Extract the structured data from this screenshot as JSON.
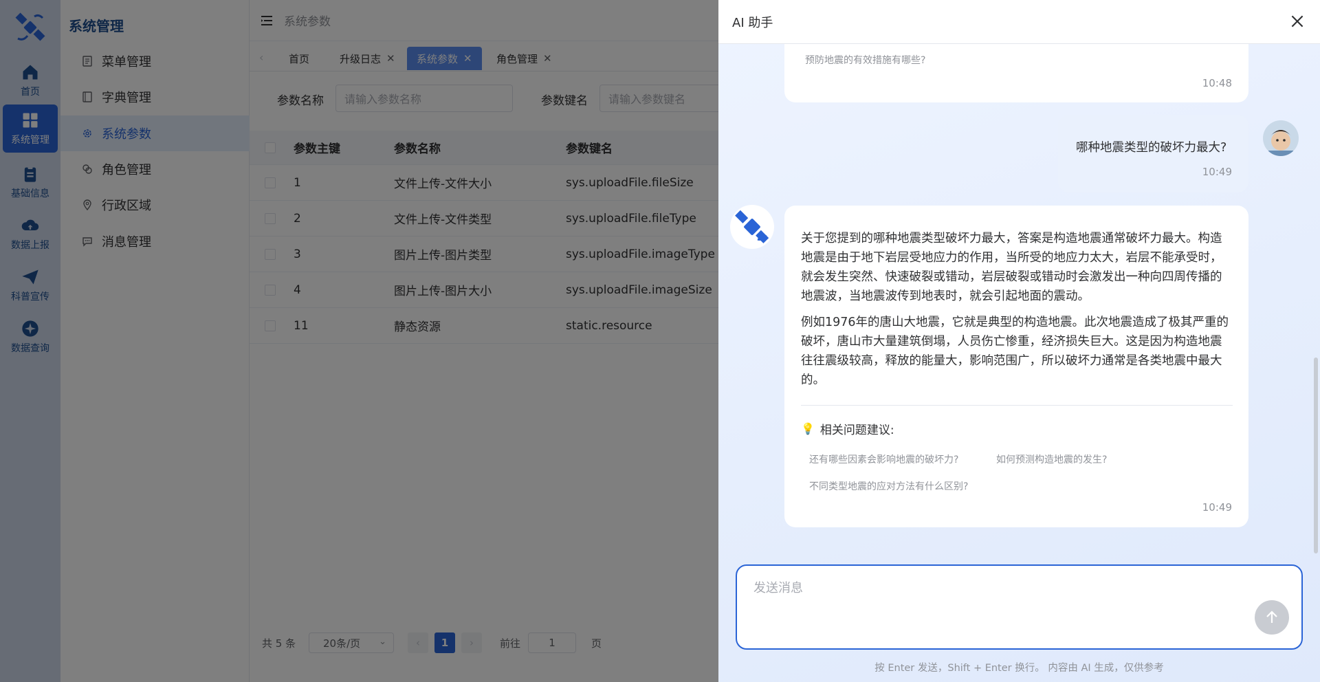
{
  "rail": {
    "items": [
      {
        "label": "首页",
        "icon": "home-icon"
      },
      {
        "label": "系统管理",
        "icon": "grid-icon",
        "active": true
      },
      {
        "label": "基础信息",
        "icon": "clipboard-icon"
      },
      {
        "label": "数据上报",
        "icon": "cloud-upload-icon"
      },
      {
        "label": "科普宣传",
        "icon": "paper-plane-icon"
      },
      {
        "label": "数据查询",
        "icon": "compass-icon"
      }
    ]
  },
  "menu": {
    "title": "系统管理",
    "items": [
      {
        "label": "菜单管理",
        "icon": "document-icon"
      },
      {
        "label": "字典管理",
        "icon": "book-icon"
      },
      {
        "label": "系统参数",
        "icon": "gear-icon",
        "active": true
      },
      {
        "label": "角色管理",
        "icon": "link-icon"
      },
      {
        "label": "行政区域",
        "icon": "location-icon"
      },
      {
        "label": "消息管理",
        "icon": "message-icon"
      }
    ]
  },
  "topbar": {
    "breadcrumb": "系统参数"
  },
  "tabs": [
    {
      "label": "首页",
      "closable": false
    },
    {
      "label": "升级日志",
      "closable": true
    },
    {
      "label": "系统参数",
      "closable": true,
      "active": true
    },
    {
      "label": "角色管理",
      "closable": true
    }
  ],
  "filters": {
    "name_label": "参数名称",
    "name_placeholder": "请输入参数名称",
    "key_label": "参数键名",
    "key_placeholder": "请输入参数键名"
  },
  "table": {
    "headers": [
      "参数主键",
      "参数名称",
      "参数键名"
    ],
    "rows": [
      [
        "1",
        "文件上传-文件大小",
        "sys.uploadFile.fileSize"
      ],
      [
        "2",
        "文件上传-文件类型",
        "sys.uploadFile.fileType"
      ],
      [
        "3",
        "图片上传-图片类型",
        "sys.uploadFile.imageType"
      ],
      [
        "4",
        "图片上传-图片大小",
        "sys.uploadFile.imageSize"
      ],
      [
        "11",
        "静态资源",
        "static.resource"
      ]
    ]
  },
  "pagination": {
    "total": "共 5 条",
    "page_size": "20条/页",
    "current": "1",
    "goto_label": "前往",
    "goto_value": "1",
    "page_suffix": "页"
  },
  "drawer": {
    "title": "AI 助手",
    "prev_question": "预防地震的有效措施有哪些?",
    "prev_time": "10:48",
    "user_message": "哪种地震类型的破坏力最大?",
    "user_time": "10:49",
    "answer_p1": "关于您提到的哪种地震类型破坏力最大，答案是构造地震通常破坏力最大。构造地震是由于地下岩层受地应力的作用，当所受的地应力太大，岩层不能承受时，就会发生突然、快速破裂或错动，岩层破裂或错动时会激发出一种向四周传播的地震波，当地震波传到地表时，就会引起地面的震动。",
    "answer_p2": "例如1976年的唐山大地震，它就是典型的构造地震。此次地震造成了极其严重的破坏，唐山市大量建筑倒塌，人员伤亡惨重，经济损失巨大。这是因为构造地震往往震级较高，释放的能量大，影响范围广，所以破坏力通常是各类地震中最大的。",
    "suggestions_title": "相关问题建议:",
    "suggestions": [
      "还有哪些因素会影响地震的破坏力?",
      "如何预测构造地震的发生?",
      "不同类型地震的应对方法有什么区别?"
    ],
    "answer_time": "10:49",
    "input_placeholder": "发送消息",
    "footnote": "按 Enter 发送，Shift + Enter 换行。 内容由 AI 生成，仅供参考"
  },
  "colors": {
    "primary": "#2a64d6",
    "rail_bg": "#ced9eb",
    "overlay": "rgba(0,0,0,0.5)",
    "tab_active": "#5b8def"
  }
}
